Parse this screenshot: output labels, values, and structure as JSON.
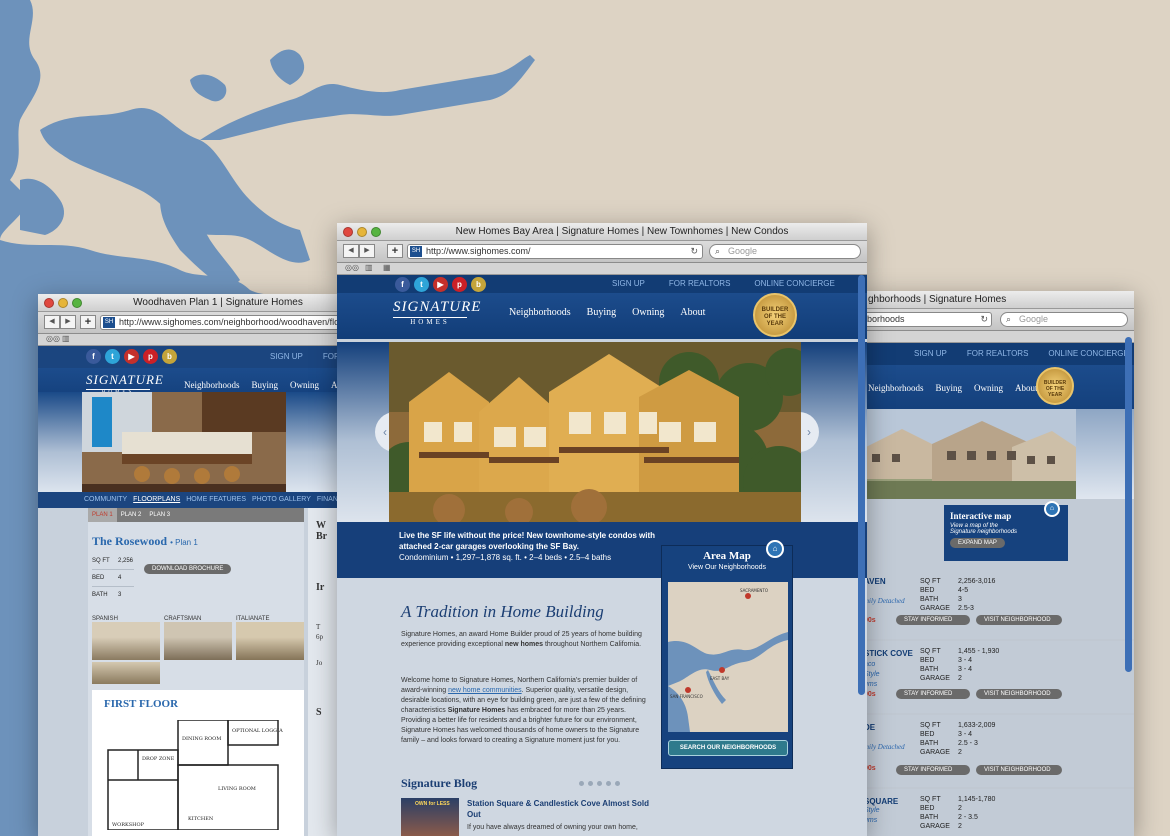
{
  "colors": {
    "navy": "#123c74",
    "blue": "#1c4c8c",
    "map_water": "#6d92bb",
    "map_land": "#ddd3c4"
  },
  "center": {
    "window_title": "New Homes Bay Area | Signature Homes | New Townhomes | New Condos",
    "url": "http://www.sighomes.com/",
    "search_placeholder": "Google",
    "favicon": "SH",
    "social_icons": [
      "facebook-icon",
      "twitter-icon",
      "youtube-icon",
      "pinterest-icon",
      "blog-icon"
    ],
    "top_links": [
      "SIGN UP",
      "FOR REALTORS",
      "ONLINE CONCIERGE"
    ],
    "logo": {
      "main": "SIGNATURE",
      "sub": "HOMES"
    },
    "nav": [
      "Neighborhoods",
      "Buying",
      "Owning",
      "About"
    ],
    "badge": {
      "l1": "BUILDER",
      "l2": "OF THE",
      "l3": "YEAR"
    },
    "tagline": {
      "l1": "Live the SF life without the price! New townhome-style condos with",
      "l2": "attached 2-car garages overlooking the SF Bay.",
      "l3": "Condominium • 1,297–1,878 sq. ft. • 2–4 beds • 2.5–4 baths"
    },
    "area_map": {
      "title": "Area Map",
      "sub": "View Our Neighborhoods",
      "cities": [
        "SACRAMENTO",
        "EAST BAY",
        "SAN FRANCISCO"
      ],
      "button": "SEARCH OUR NEIGHBORHOODS"
    },
    "tradition_title": "A Tradition in Home Building",
    "para1": {
      "a": "Signature Homes, an award Home Builder proud of 25 years of home building experience providing exceptional ",
      "bold": "new homes",
      "b": " throughout Northern California."
    },
    "para2": {
      "a": "Welcome home to Signature Homes, Northern California's premier builder of award-winning ",
      "link": "new home communities",
      "b": ".  Superior quality, versatile design, desirable locations, with an eye for building green, are just a few of the defining characteristics ",
      "bold": "Signature Homes",
      "c": " has embraced for more than 25 years.  Providing a better life for residents and a brighter future for our environment, Signature Homes has welcomed thousands of home owners to the Signature family – and looks forward to creating a Signature moment just for you."
    },
    "blog": {
      "title": "Signature Blog",
      "post_title": "Station Square & Candlestick Cove Almost Sold Out",
      "post_text": "If you have always dreamed of owning your own home,",
      "thumb_text": "OWN for LESS"
    }
  },
  "left": {
    "window_title": "Woodhaven Plan 1 | Signature Homes",
    "url": "http://www.sighomes.com/neighborhood/woodhaven/floorplans/",
    "top_links": [
      "SIGN UP",
      "FOR REA"
    ],
    "nav": [
      "Neighborhoods",
      "Buying",
      "Owning",
      "A"
    ],
    "subnav": [
      "COMMUNITY",
      "FLOORPLANS",
      "HOME FEATURES",
      "PHOTO GALLERY",
      "FINANCING"
    ],
    "plan_tabs": [
      "PLAN 1",
      "PLAN 2",
      "PLAN 3"
    ],
    "plan_name": "The Rosewood",
    "plan_num": "• Plan 1",
    "specs": [
      {
        "k": "SQ FT",
        "v": "2,256"
      },
      {
        "k": "BED",
        "v": "4"
      },
      {
        "k": "BATH",
        "v": "3"
      }
    ],
    "download": "DOWNLOAD BROCHURE",
    "styles": [
      "SPANISH",
      "CRAFTSMAN",
      "ITALIANATE"
    ],
    "floor_title": "FIRST FLOOR",
    "rooms": [
      "DINING ROOM",
      "OPTIONAL LOGGIA",
      "LIVING ROOM",
      "KITCHEN",
      "WORKSHOP",
      "DROP ZONE"
    ],
    "side_frag": {
      "a": "W",
      "b": "Br",
      "c": "Ir",
      "d": "T",
      "e": "6p",
      "f": "Jo",
      "g": "S"
    }
  },
  "right": {
    "window_title": "ghborhoods | Signature Homes",
    "url": "borhoods",
    "search_placeholder": "Google",
    "top_links": [
      "SIGN UP",
      "FOR REALTORS",
      "ONLINE CONCIERGE"
    ],
    "nav": [
      "Neighborhoods",
      "Buying",
      "Owning",
      "About"
    ],
    "imap": {
      "title": "Interactive map",
      "l1": "View a map of the",
      "l2": "Signature neighborhoods",
      "button": "EXPAND MAP"
    },
    "buttons": {
      "stay": "STAY INFORMED",
      "visit": "VISIT NEIGHBORHOOD"
    },
    "rows": [
      {
        "name": "AVEN",
        "sub": "mily Detached",
        "price": "00s",
        "specs": [
          [
            "SQ FT",
            "2,256-3,016"
          ],
          [
            "BED",
            "4-5"
          ],
          [
            "BATH",
            "3"
          ],
          [
            "GARAGE",
            "2.5-3"
          ]
        ]
      },
      {
        "name": "STICK COVE",
        "sub": "aco",
        "sub2": "Style",
        "sub3": "ums",
        "price": "00s",
        "specs": [
          [
            "SQ FT",
            "1,455 - 1,930"
          ],
          [
            "BED",
            "3 - 4"
          ],
          [
            "BATH",
            "3 - 4"
          ],
          [
            "GARAGE",
            "2"
          ]
        ]
      },
      {
        "name": "DE",
        "sub": "mily Detached",
        "price": "00s",
        "specs": [
          [
            "SQ FT",
            "1,633-2,009"
          ],
          [
            "BED",
            "3 - 4"
          ],
          [
            "BATH",
            "2.5 - 3"
          ],
          [
            "GARAGE",
            "2"
          ]
        ]
      },
      {
        "name": "SQUARE",
        "sub": "Style",
        "sub2": "ums",
        "price": "",
        "specs": [
          [
            "SQ FT",
            "1,145-1,780"
          ],
          [
            "BED",
            "2"
          ],
          [
            "BATH",
            "2 - 3.5"
          ],
          [
            "GARAGE",
            "2"
          ]
        ]
      }
    ]
  }
}
